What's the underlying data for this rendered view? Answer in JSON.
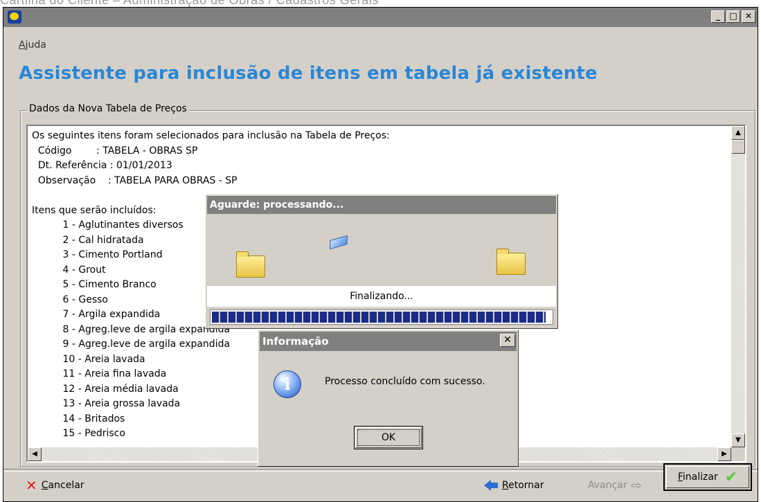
{
  "page_caption": "Cartilha do Cliente – Administração de Obras / Cadastros Gerais",
  "window": {
    "controls": {
      "minimize": "_",
      "maximize": "□",
      "close": "✕"
    },
    "menu": [
      "Ajuda"
    ],
    "headline": "Assistente para inclusão de itens em tabela já existente"
  },
  "group": {
    "legend": "Dados da Nova Tabela de Preços",
    "content_lines": [
      "Os seguintes itens foram selecionados para inclusão na Tabela de Preços:",
      "  Código        : TABELA - OBRAS SP",
      "  Dt. Referência : 01/01/2013",
      "  Observação    : TABELA PARA OBRAS - SP",
      "",
      "Itens que serão incluídos:",
      "          1 - Aglutinantes diversos",
      "          2 - Cal hidratada",
      "          3 - Cimento Portland",
      "          4 - Grout",
      "          5 - Cimento Branco",
      "          6 - Gesso",
      "          7 - Argila expandida",
      "          8 - Agreg.leve de argila expandida",
      "          9 - Agreg.leve de argila expandida",
      "          10 - Areia lavada",
      "          11 - Areia fina lavada",
      "          12 - Areia média lavada",
      "          13 - Areia grossa lavada",
      "          14 - Britados",
      "          15 - Pedrisco"
    ]
  },
  "footer": {
    "cancel": "Cancelar",
    "back": "Retornar",
    "next": "Avançar",
    "finish": "Finalizar"
  },
  "progress_dialog": {
    "title": "Aguarde: processando...",
    "status": "Finalizando...",
    "progress": 1.0
  },
  "info_dialog": {
    "title": "Informação",
    "message": "Processo concluído com sucesso.",
    "ok": "OK",
    "icon": "info-icon"
  }
}
